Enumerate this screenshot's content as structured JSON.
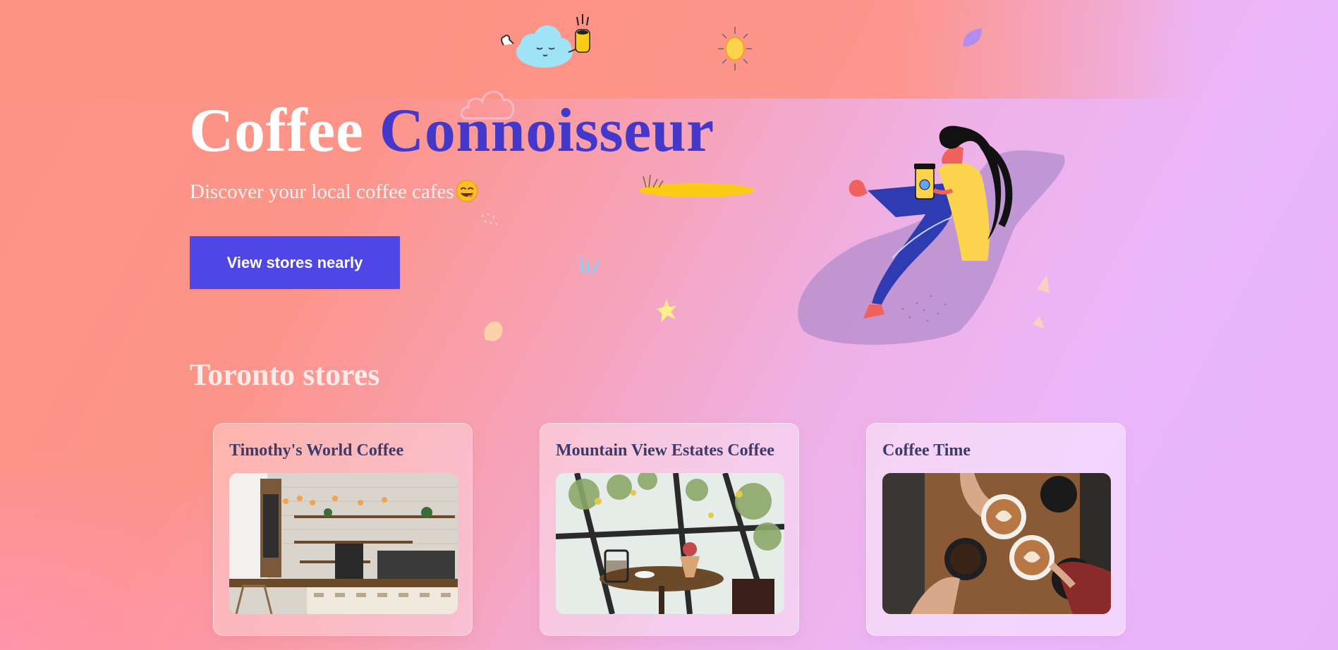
{
  "hero": {
    "title_word1": "Coffee",
    "title_word2": "Connoisseur",
    "subtitle": "Discover your local coffee cafes",
    "cta_label": "View stores nearly"
  },
  "stores_section": {
    "title": "Toronto stores",
    "stores": [
      {
        "name": "Timothy's World Coffee",
        "image": "cafe-counter-photo"
      },
      {
        "name": "Mountain View Estates Coffee",
        "image": "cafe-window-table-photo"
      },
      {
        "name": "Coffee Time",
        "image": "latte-cheers-photo"
      }
    ]
  },
  "colors": {
    "accent": "#4f46e5",
    "title_accent": "#4338ca",
    "card_title": "#3b3a6b"
  },
  "icons": [
    "smiling-face-emoji-icon",
    "cloud-icon",
    "coffee-cup-icon",
    "sun-icon",
    "leaf-icon",
    "flower-icon",
    "grass-icon"
  ]
}
